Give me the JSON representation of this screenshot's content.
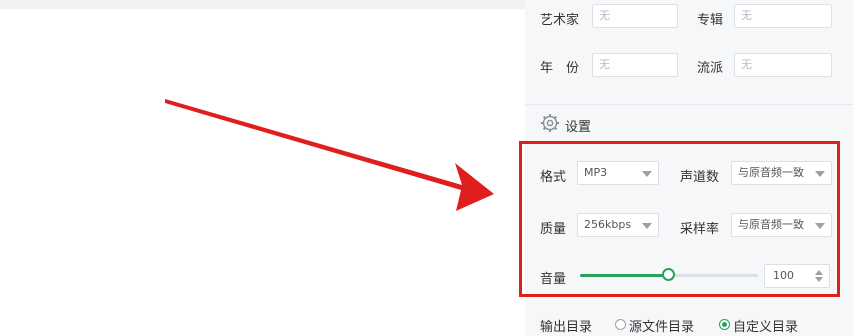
{
  "metadata": {
    "artist_label": "艺术家",
    "artist_value": "无",
    "album_label": "专辑",
    "album_value": "无",
    "year_label": "年　份",
    "year_value": "无",
    "genre_label": "流派",
    "genre_value": "无"
  },
  "settings": {
    "title": "设置",
    "icon": "gear-icon",
    "format_label": "格式",
    "format_value": "MP3",
    "channels_label": "声道数",
    "channels_value": "与原音频一致",
    "quality_label": "质量",
    "quality_value": "256kbps",
    "samplerate_label": "采样率",
    "samplerate_value": "与原音频一致",
    "volume_label": "音量",
    "volume_value": "100",
    "volume_level_fraction": 0.5
  },
  "output": {
    "label": "输出目录",
    "options": [
      {
        "label": "源文件目录",
        "selected": false
      },
      {
        "label": "自定义目录",
        "selected": true
      }
    ]
  },
  "colors": {
    "accent_green": "#2aa05a",
    "highlight_red": "#e01e1e",
    "panel_bg": "#f6f7f9"
  }
}
